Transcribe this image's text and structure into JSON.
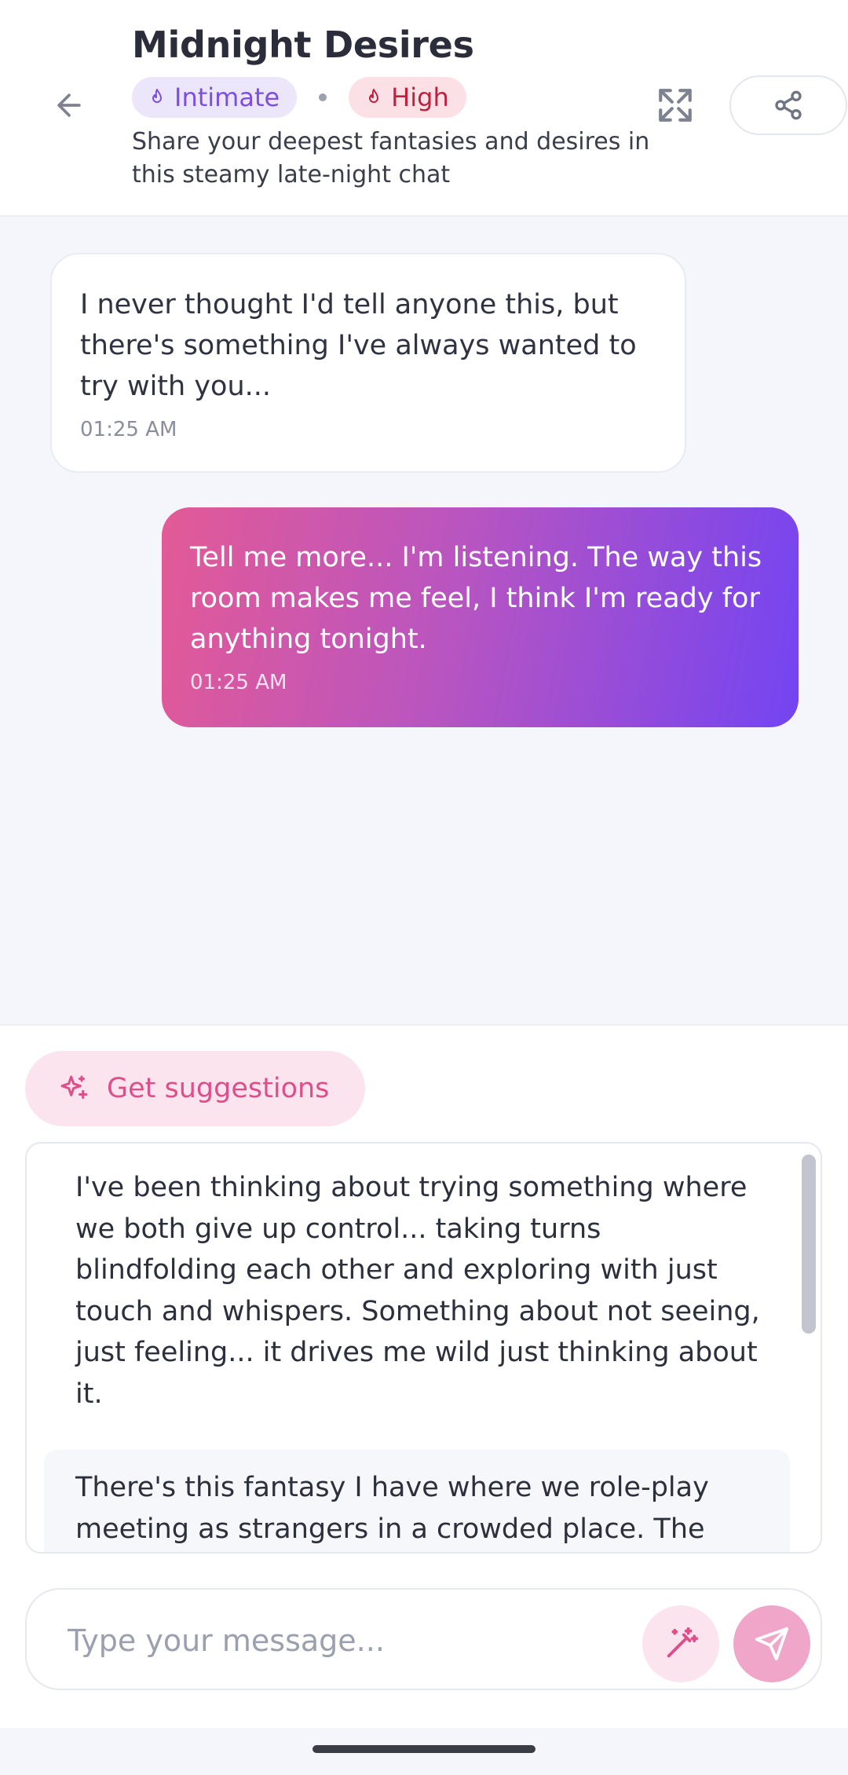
{
  "header": {
    "title": "Midnight Desires",
    "tags": [
      {
        "label": "Intimate",
        "icon": "flame-icon",
        "color": "#7c4ee4"
      },
      {
        "label": "High",
        "icon": "flame-icon",
        "color": "#c0203f"
      }
    ],
    "subtitle": "Share your deepest fantasies and desires in this steamy late-night chat"
  },
  "messages": [
    {
      "sender": "other",
      "text": "I never thought I'd tell anyone this, but there's something I've always wanted to try with you...",
      "time": "01:25 AM"
    },
    {
      "sender": "self",
      "text": "Tell me more... I'm listening. The way this room makes me feel, I think I'm ready for anything tonight.",
      "time": "01:25 AM"
    }
  ],
  "composer": {
    "suggest_label": "Get suggestions",
    "suggestions": [
      "I've been thinking about trying something where we both give up control... taking turns blindfolding each other and exploring with just touch and whispers. Something about not seeing, just feeling... it drives me wild just thinking about it.",
      "There's this fantasy I have where we role-play meeting as strangers in a crowded place. The"
    ],
    "input_placeholder": "Type your message...",
    "input_value": ""
  },
  "colors": {
    "accent_pink": "#dc4f8a",
    "accent_purple": "#7344f2",
    "gradient_start": "#e35a96"
  }
}
